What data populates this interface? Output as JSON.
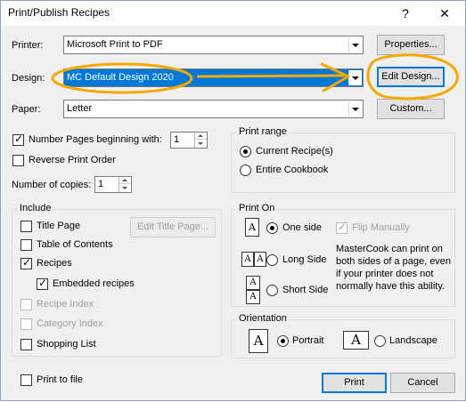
{
  "window": {
    "title": "Print/Publish Recipes",
    "help": "?",
    "close": "✕"
  },
  "printer": {
    "label": "Printer:",
    "value": "Microsoft Print to PDF",
    "button": "Properties..."
  },
  "design": {
    "label": "Design:",
    "value": "MC Default Design 2020",
    "button": "Edit Design..."
  },
  "paper": {
    "label": "Paper:",
    "value": "Letter",
    "button": "Custom..."
  },
  "number_pages": {
    "label": "Number Pages beginning with:",
    "checked": true,
    "value": "1"
  },
  "reverse": {
    "label": "Reverse Print Order",
    "checked": false
  },
  "copies": {
    "label": "Number of copies:",
    "value": "1"
  },
  "print_range": {
    "legend": "Print range",
    "options": [
      "Current Recipe(s)",
      "Entire Cookbook"
    ],
    "selected": "Current Recipe(s)"
  },
  "include": {
    "legend": "Include",
    "edit_title_button": "Edit Title Page...",
    "items": {
      "title_page": "Title Page",
      "toc": "Table of Contents",
      "recipes": "Recipes",
      "embedded": "Embedded recipes",
      "recipe_index": "Recipe Index",
      "category_index": "Category Index",
      "shopping_list": "Shopping List"
    }
  },
  "print_on": {
    "legend": "Print On",
    "one_side": "One side",
    "long_side": "Long Side",
    "short_side": "Short Side",
    "flip_manually": "Flip Manually",
    "info": "MasterCook can print on both sides of a page, even if your printer does not normally have this ability.",
    "icon_glyph": "A"
  },
  "orientation": {
    "legend": "Orientation",
    "portrait": "Portrait",
    "landscape": "Landscape",
    "selected": "Portrait"
  },
  "print_to_file": {
    "label": "Print to file",
    "checked": false
  },
  "buttons": {
    "print": "Print",
    "cancel": "Cancel"
  },
  "annotation_color": "#f5a800"
}
